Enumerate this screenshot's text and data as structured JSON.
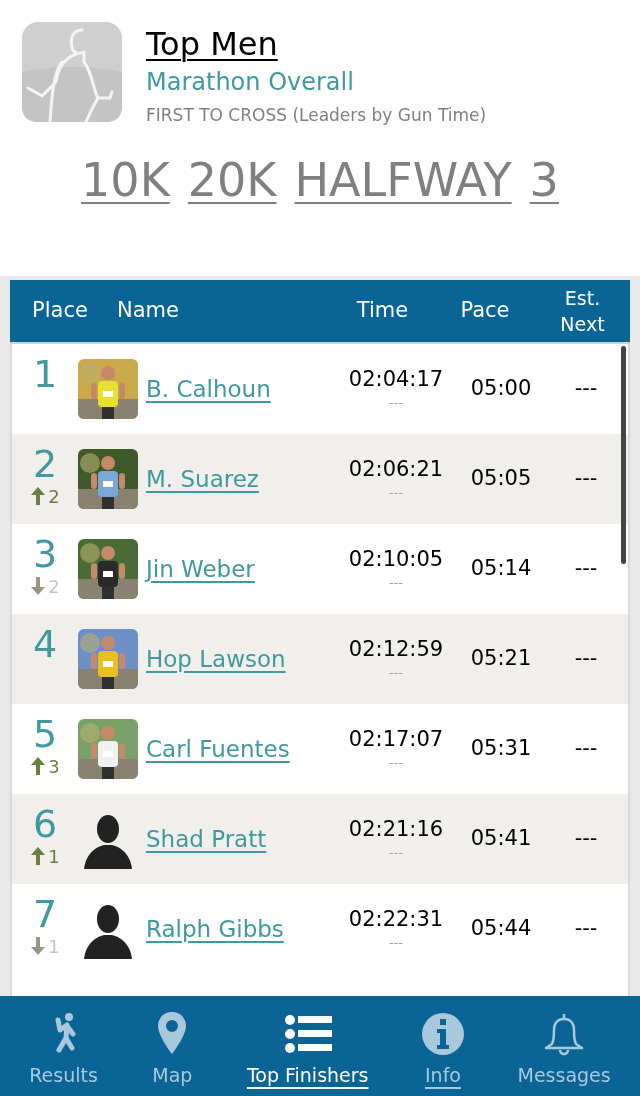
{
  "header": {
    "title": "Top Men",
    "subtitle": "Marathon Overall",
    "caption": "FIRST TO CROSS (Leaders by Gun Time)"
  },
  "splits": [
    "10K",
    "20K",
    "HALFWAY",
    "3"
  ],
  "table": {
    "columns": [
      "Place",
      "Name",
      "Time",
      "Pace",
      "Est. Next"
    ],
    "rows": [
      {
        "place": "1",
        "name": "B. Calhoun",
        "time": "02:04:17",
        "sub_time": "---",
        "pace": "05:00",
        "est_next": "---"
      },
      {
        "place": "2",
        "movement": {
          "kind": "up",
          "count": "2"
        },
        "name": "M. Suarez",
        "time": "02:06:21",
        "sub_time": "---",
        "pace": "05:05",
        "est_next": "---"
      },
      {
        "place": "3",
        "movement": {
          "kind": "down",
          "count": "2"
        },
        "name": "Jin Weber",
        "time": "02:10:05",
        "sub_time": "---",
        "pace": "05:14",
        "est_next": "---"
      },
      {
        "place": "4",
        "name": "Hop Lawson",
        "time": "02:12:59",
        "sub_time": "---",
        "pace": "05:21",
        "est_next": "---"
      },
      {
        "place": "5",
        "movement": {
          "kind": "up",
          "count": "3"
        },
        "name": "Carl Fuentes",
        "time": "02:17:07",
        "sub_time": "---",
        "pace": "05:31",
        "est_next": "---"
      },
      {
        "place": "6",
        "movement": {
          "kind": "up",
          "count": "1"
        },
        "avatar": {
          "kind": "silhouette"
        },
        "name": "Shad Pratt",
        "time": "02:21:16",
        "sub_time": "---",
        "pace": "05:41",
        "est_next": "---"
      },
      {
        "place": "7",
        "movement": {
          "kind": "down",
          "count": "1"
        },
        "avatar": {
          "kind": "silhouette"
        },
        "name": "Ralph Gibbs",
        "time": "02:22:31",
        "sub_time": "---",
        "pace": "05:44",
        "est_next": "---"
      }
    ]
  },
  "tabs": [
    {
      "kind": "results",
      "label": "Results",
      "selected": false,
      "underlined": false
    },
    {
      "kind": "map",
      "label": "Map",
      "selected": false,
      "underlined": false
    },
    {
      "kind": "list",
      "label": "Top Finishers",
      "selected": true,
      "underlined": true
    },
    {
      "kind": "info",
      "label": "Info",
      "selected": false,
      "underlined": true
    },
    {
      "kind": "bell",
      "label": "Messages",
      "selected": false,
      "underlined": false
    }
  ]
}
